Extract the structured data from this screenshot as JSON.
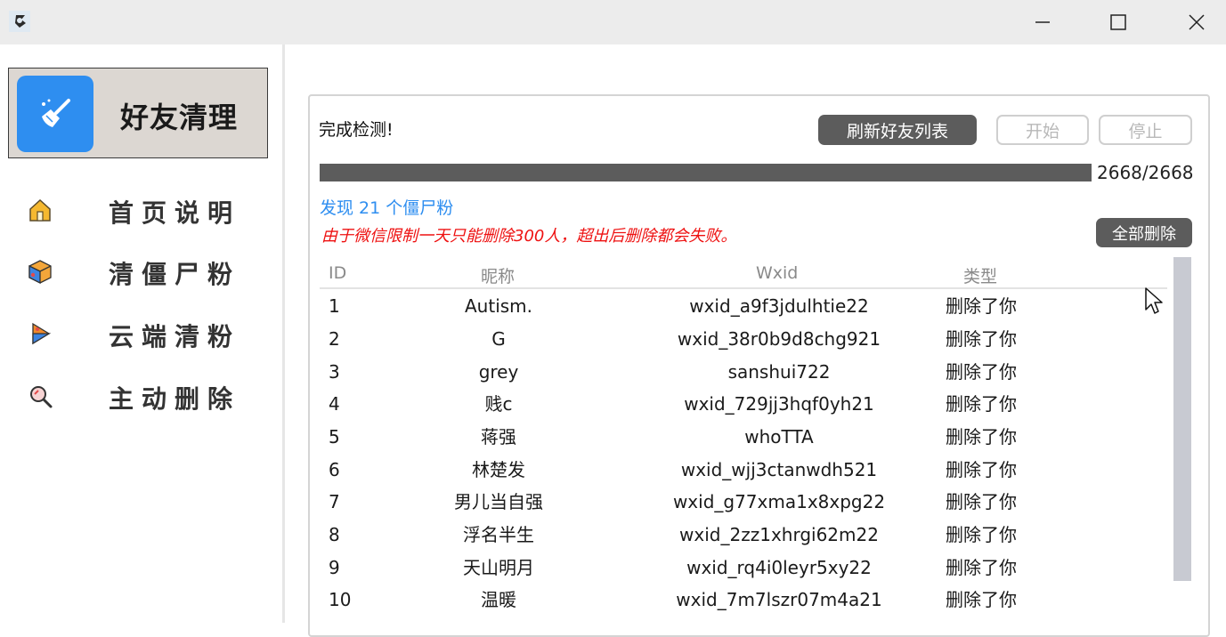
{
  "window": {
    "controls": {
      "min_icon": "minimize-icon",
      "max_icon": "maximize-icon",
      "close_icon": "close-icon"
    }
  },
  "sidebar": {
    "brand": {
      "title": "好友清理",
      "icon": "broom-icon",
      "accent": "#2e8ef0"
    },
    "items": [
      {
        "label": "首页说明",
        "icon": "home-icon"
      },
      {
        "label": "清僵尸粉",
        "icon": "cube-icon"
      },
      {
        "label": "云端清粉",
        "icon": "play-icon"
      },
      {
        "label": "主动删除",
        "icon": "search-icon"
      }
    ]
  },
  "main": {
    "status": "完成检测!",
    "buttons": {
      "refresh": "刷新好友列表",
      "start": "开始",
      "stop": "停止",
      "delete_all": "全部删除"
    },
    "progress": {
      "current": 2668,
      "total": 2668,
      "text": "2668/2668"
    },
    "found_text": "发现 21 个僵尸粉",
    "warning_text": "由于微信限制一天只能删除300人，超出后删除都会失败。",
    "table": {
      "headers": [
        "ID",
        "昵称",
        "Wxid",
        "类型"
      ],
      "rows": [
        {
          "id": "1",
          "nickname": "Autism.",
          "wxid": "wxid_a9f3jdulhtie22",
          "type": "删除了你"
        },
        {
          "id": "2",
          "nickname": "G",
          "wxid": "wxid_38r0b9d8chg921",
          "type": "删除了你"
        },
        {
          "id": "3",
          "nickname": "grey",
          "wxid": "sanshui722",
          "type": "删除了你"
        },
        {
          "id": "4",
          "nickname": "贱c",
          "wxid": "wxid_729jj3hqf0yh21",
          "type": "删除了你"
        },
        {
          "id": "5",
          "nickname": "蒋强",
          "wxid": "whoTTA",
          "type": "删除了你"
        },
        {
          "id": "6",
          "nickname": "林楚发",
          "wxid": "wxid_wjj3ctanwdh521",
          "type": "删除了你"
        },
        {
          "id": "7",
          "nickname": "男儿当自强",
          "wxid": "wxid_g77xma1x8xpg22",
          "type": "删除了你"
        },
        {
          "id": "8",
          "nickname": "浮名半生",
          "wxid": "wxid_2zz1xhrgi62m22",
          "type": "删除了你"
        },
        {
          "id": "9",
          "nickname": "天山明月",
          "wxid": "wxid_rq4i0leyr5xy22",
          "type": "删除了你"
        },
        {
          "id": "10",
          "nickname": "温暖",
          "wxid": "wxid_7m7lszr07m4a21",
          "type": "删除了你"
        }
      ]
    }
  }
}
